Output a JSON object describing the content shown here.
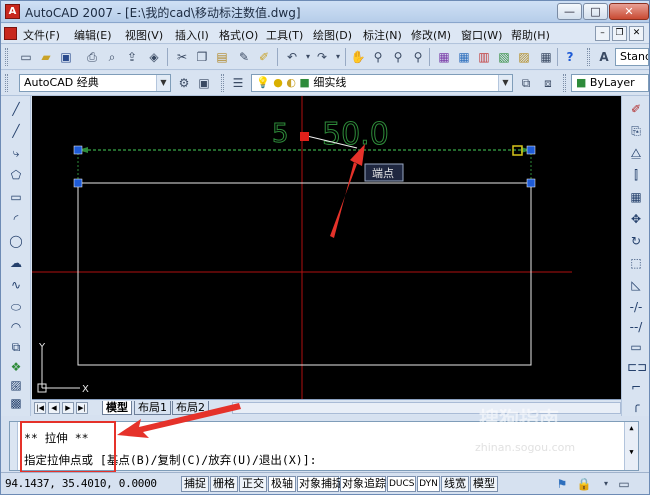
{
  "titlebar": {
    "app_icon": "A",
    "title": "AutoCAD 2007 - [E:\\我的cad\\移动标注数值.dwg]",
    "min": "—",
    "max": "□",
    "close": "✕"
  },
  "menubar": {
    "items": [
      "文件(F)",
      "编辑(E)",
      "视图(V)",
      "插入(I)",
      "格式(O)",
      "工具(T)",
      "绘图(D)",
      "标注(N)",
      "修改(M)",
      "窗口(W)",
      "帮助(H)"
    ]
  },
  "toolbar1": {
    "text_style": "Stand"
  },
  "toolbar2": {
    "workspace": "AutoCAD 经典",
    "layer": "细实线",
    "color": "ByLayer"
  },
  "drawing": {
    "dimension_text": "50.0",
    "hidden_label": "5",
    "tooltip": "端点",
    "ucs_y": "Y",
    "ucs_x": "X"
  },
  "tabs": {
    "model": "模型",
    "layout1": "布局1",
    "layout2": "布局2"
  },
  "command": {
    "line1": "** 拉伸 **",
    "line2": "指定拉伸点或 [基点(B)/复制(C)/放弃(U)/退出(X)]:"
  },
  "status": {
    "coords": "94.1437,  35.4010, 0.0000",
    "buttons": [
      "捕捉",
      "栅格",
      "正交",
      "极轴",
      "对象捕捉",
      "对象追踪",
      "DUCS",
      "DYN",
      "线宽",
      "模型"
    ]
  },
  "watermark": {
    "text": "搜狗指南",
    "url": "zhinan.sogou.com"
  },
  "colors": {
    "dim_green": "#2e8b3a",
    "grip_blue": "#1e5bd6",
    "grip_red": "#e0201a",
    "annotation_red": "#e5322a",
    "canvas": "#000000"
  }
}
